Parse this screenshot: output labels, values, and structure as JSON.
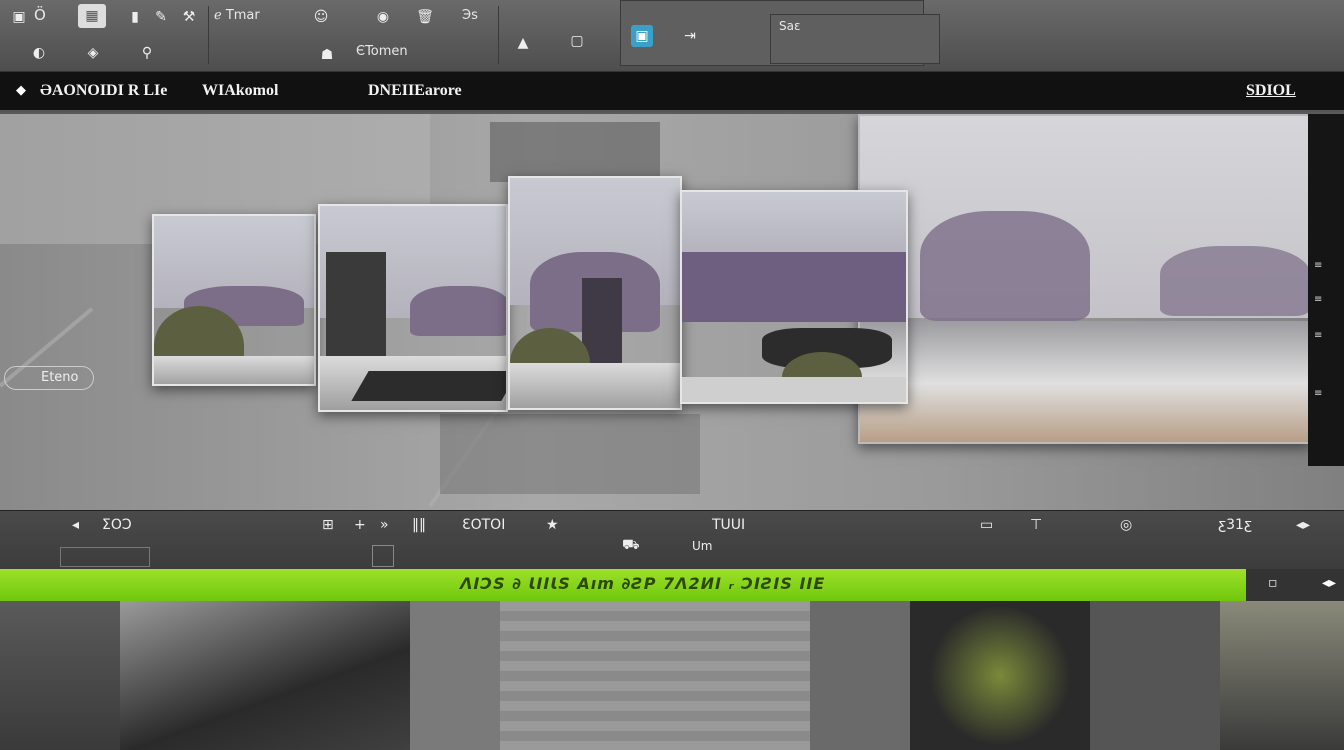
{
  "toolbar": {
    "row1": [
      "Ö",
      "ℯ Tmar",
      "Эs",
      "Saɛ"
    ],
    "row2": [
      "ЄTomen"
    ],
    "icons": [
      "gallery-icon",
      "grid-icon",
      "paint-icon",
      "brush-icon",
      "face-icon",
      "trash-icon",
      "camera-icon",
      "lock-icon",
      "hammer-icon",
      "cursor-icon",
      "frame-icon",
      "monitor-icon",
      "export-icon"
    ]
  },
  "menubar": {
    "items": [
      "ƏAONOIDI R LIe",
      "WIAkomol",
      "DNEIIEarore"
    ],
    "right": "SDIOL"
  },
  "canvas": {
    "label": "Eteno"
  },
  "timeline": {
    "left": "ƩOƆ",
    "mid": "ƐOTOI",
    "right_label": "TUUI",
    "sub": "Um",
    "counter": "ƹ31ƹ"
  },
  "status": {
    "text": "ɅIƆS ∂ ƖIIƖS Aım ∂ƧP 7Λ2ИI ᵣ ƆIƧIS IIE"
  },
  "colors": {
    "accent": "#7ecf14",
    "menubar": "#111111",
    "toolbar": "#5a5a5a"
  }
}
